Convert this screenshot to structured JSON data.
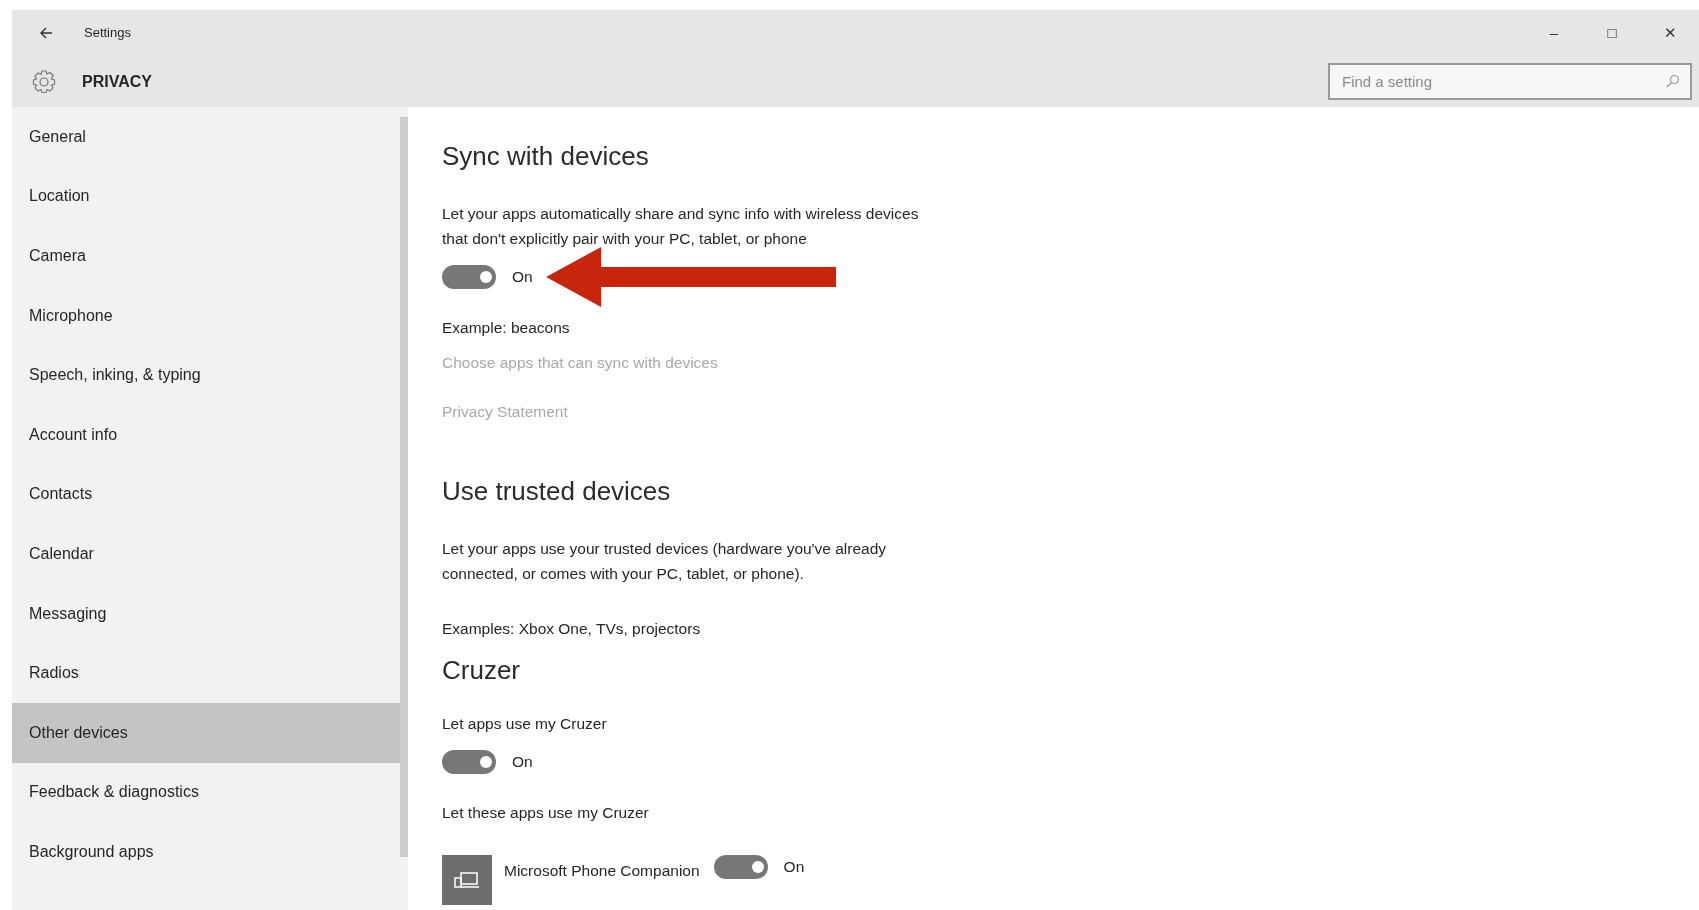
{
  "window": {
    "title": "Settings",
    "controls": [
      "–",
      "□",
      "✕"
    ]
  },
  "header": {
    "title": "PRIVACY",
    "search": {
      "placeholder": "Find a setting"
    }
  },
  "sidebar": {
    "items": [
      {
        "label": "General",
        "selected": false
      },
      {
        "label": "Location",
        "selected": false
      },
      {
        "label": "Camera",
        "selected": false
      },
      {
        "label": "Microphone",
        "selected": false
      },
      {
        "label": "Speech, inking, & typing",
        "selected": false
      },
      {
        "label": "Account info",
        "selected": false
      },
      {
        "label": "Contacts",
        "selected": false
      },
      {
        "label": "Calendar",
        "selected": false
      },
      {
        "label": "Messaging",
        "selected": false
      },
      {
        "label": "Radios",
        "selected": false
      },
      {
        "label": "Other devices",
        "selected": true
      },
      {
        "label": "Feedback & diagnostics",
        "selected": false
      },
      {
        "label": "Background apps",
        "selected": false
      }
    ]
  },
  "content": [
    {
      "kind": "heading",
      "text": "Sync with devices"
    },
    {
      "kind": "text",
      "text": "Let your apps automatically share and sync info with wireless devices that don't explicitly pair with your PC, tablet, or phone"
    },
    {
      "kind": "toggle",
      "on": true,
      "label": "On",
      "annotated": true
    },
    {
      "kind": "text",
      "text": "Example: beacons"
    },
    {
      "kind": "link",
      "text": "Choose apps that can sync with devices"
    },
    {
      "kind": "link",
      "text": "Privacy Statement"
    },
    {
      "kind": "heading",
      "text": "Use trusted devices"
    },
    {
      "kind": "text",
      "text": "Let your apps use your trusted devices (hardware you've already connected, or comes with your PC, tablet, or phone)."
    },
    {
      "kind": "text",
      "text": "Examples: Xbox One, TVs, projectors"
    },
    {
      "kind": "heading",
      "text": "Cruzer"
    },
    {
      "kind": "text",
      "text": "Let apps use my Cruzer"
    },
    {
      "kind": "toggle",
      "on": true,
      "label": "On",
      "annotated": false
    },
    {
      "kind": "text",
      "text": "Let these apps use my Cruzer"
    },
    {
      "kind": "app",
      "name": "Microsoft Phone Companion",
      "on": true,
      "label": "On"
    }
  ]
}
